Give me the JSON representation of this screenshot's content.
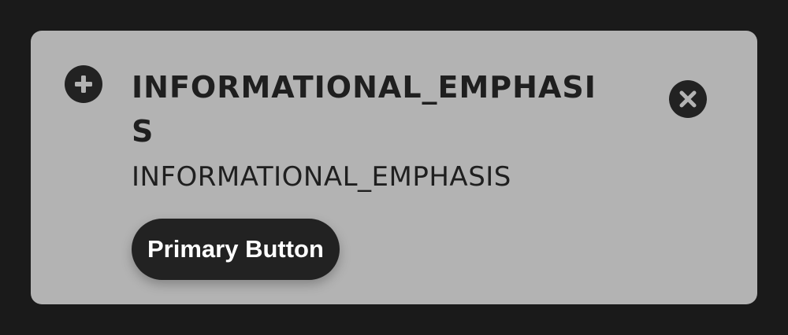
{
  "banner": {
    "title": "INFORMATIONAL_EMPHASIS",
    "description": "INFORMATIONAL_EMPHASIS",
    "primary_button_label": "Primary Button",
    "leading_icon": "plus-circle-icon",
    "close_icon": "close-circle-icon"
  },
  "colors": {
    "page_background": "#1a1a1a",
    "banner_background": "#b3b3b3",
    "text": "#1f1f1f",
    "button_background": "#222222",
    "button_text": "#ffffff"
  }
}
